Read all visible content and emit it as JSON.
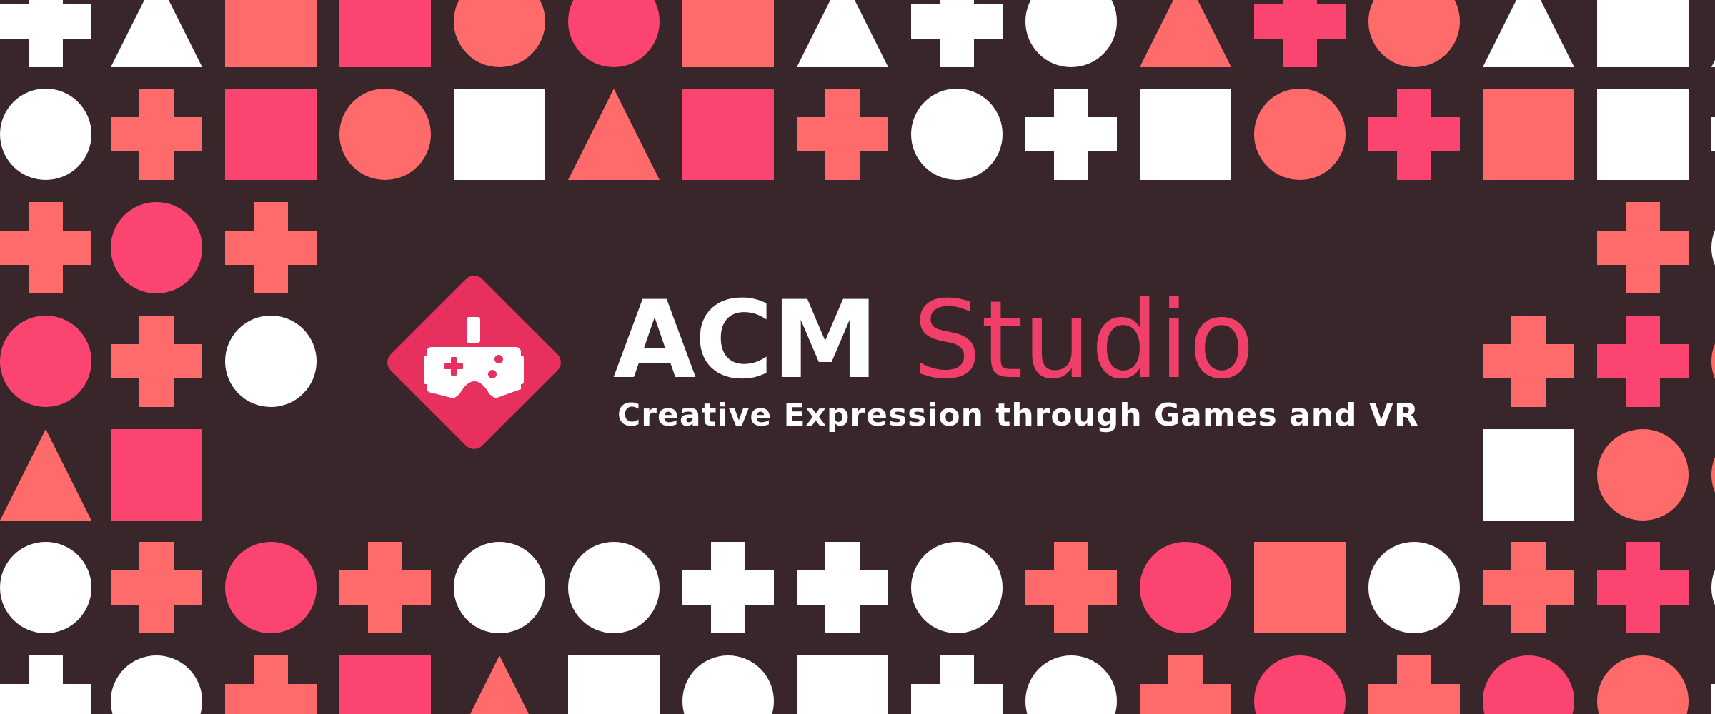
{
  "brand": {
    "name_primary": "ACM",
    "name_secondary": "Studio",
    "tagline": "Creative Expression through Games and VR",
    "logo_icon": "game-controller-icon"
  },
  "colors": {
    "background": "#39262b",
    "white": "#ffffff",
    "coral": "#ff6b6b",
    "pink": "#fb4570",
    "accent_text": "#f0406a",
    "logo_badge": "#e8305f"
  },
  "pattern": {
    "description_shapes": [
      "plus",
      "triangle",
      "square",
      "circle"
    ],
    "rows": [
      [
        "plus:white",
        "triangle:white",
        "square:coral",
        "square:pink",
        "circle:coral",
        "circle:pink",
        "square:coral",
        "triangle:white",
        "plus:white",
        "circle:white",
        "triangle:coral",
        "plus:pink",
        "circle:coral",
        "triangle:white",
        "square:white",
        "triangle:white"
      ],
      [
        "circle:white",
        "plus:coral",
        "square:pink",
        "circle:coral",
        "square:white",
        "triangle:coral",
        "square:pink",
        "plus:coral",
        "circle:white",
        "plus:white",
        "square:white",
        "circle:coral",
        "plus:pink",
        "square:coral",
        "square:white",
        "plus:white"
      ],
      [
        "plus:coral",
        "circle:pink",
        "plus:coral",
        "",
        "",
        "",
        "",
        "",
        "",
        "",
        "",
        "",
        "",
        "",
        "plus:coral",
        "circle:white"
      ],
      [
        "circle:pink",
        "plus:coral",
        "circle:white",
        "",
        "",
        "",
        "",
        "",
        "",
        "",
        "",
        "",
        "",
        "plus:coral",
        "plus:pink",
        "circle:coral"
      ],
      [
        "triangle:coral",
        "square:pink",
        "",
        "",
        "",
        "",
        "",
        "",
        "",
        "",
        "",
        "",
        "",
        "square:white",
        "circle:coral",
        "circle:coral"
      ],
      [
        "circle:white",
        "plus:coral",
        "circle:pink",
        "plus:coral",
        "circle:white",
        "circle:white",
        "plus:white",
        "plus:white",
        "circle:white",
        "plus:coral",
        "circle:pink",
        "square:coral",
        "circle:white",
        "plus:coral",
        "plus:pink",
        "circle:white"
      ],
      [
        "plus:white",
        "circle:white",
        "plus:coral",
        "square:pink",
        "triangle:coral",
        "square:white",
        "circle:white",
        "square:white",
        "plus:white",
        "circle:white",
        "plus:coral",
        "circle:pink",
        "plus:coral",
        "circle:pink",
        "circle:coral",
        "plus:white"
      ]
    ]
  }
}
